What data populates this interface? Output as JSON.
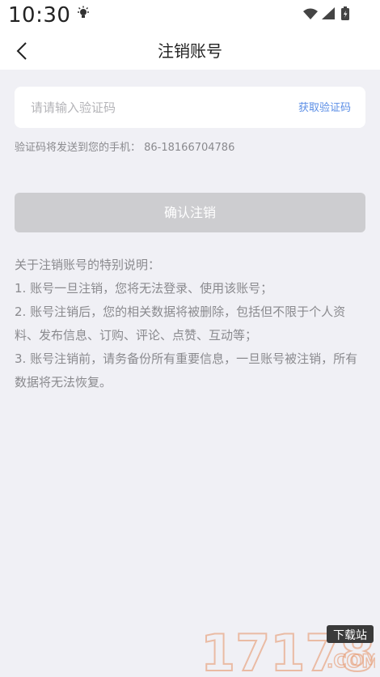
{
  "status_bar": {
    "time": "10:30"
  },
  "nav": {
    "title": "注销账号"
  },
  "code_field": {
    "placeholder": "请请输入验证码",
    "value": "",
    "get_code_label": "获取验证码"
  },
  "hint": "验证码将发送到您的手机：  86-18166704786",
  "confirm_label": "确认注销",
  "notes": {
    "heading": "关于注销账号的特别说明：",
    "items": [
      "1. 账号一旦注销，您将无法登录、使用该账号；",
      "2. 账号注销后，您的相关数据将被删除，包括但不限于个人资料、发布信息、订购、评论、点赞、互动等；",
      "3. 账号注销前，请务备份所有重要信息，一旦账号被注销，所有数据将无法恢复。"
    ]
  },
  "watermark": {
    "number": "17178",
    "tag": "下载站",
    "domain": ".COM"
  },
  "colors": {
    "background": "#f0f0f5",
    "link": "#5b8ee6",
    "button_disabled": "#cdcdd0",
    "muted_text": "#8a8a8e"
  }
}
